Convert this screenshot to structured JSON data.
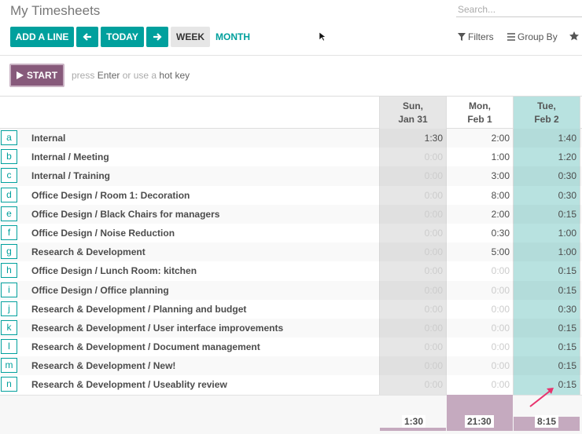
{
  "header": {
    "title": "My Timesheets",
    "search_placeholder": "Search..."
  },
  "toolbar": {
    "add_line": "ADD A LINE",
    "today": "TODAY",
    "week": "WEEK",
    "month": "MONTH",
    "filters": "Filters",
    "group_by": "Group By",
    "accent_color": "#00a09d"
  },
  "start": {
    "label": "START",
    "hint_press": "press",
    "hint_enter": "Enter",
    "hint_or": "or use a",
    "hint_hotkey": "hot key",
    "color": "#875a7b"
  },
  "columns": [
    {
      "day": "Sun,",
      "date": "Jan 31"
    },
    {
      "day": "Mon,",
      "date": "Feb 1"
    },
    {
      "day": "Tue,",
      "date": "Feb 2"
    }
  ],
  "rows": [
    {
      "key": "a",
      "task": "Internal",
      "sun": "1:30",
      "mon": "2:00",
      "tue": "1:40"
    },
    {
      "key": "b",
      "task": "Internal  /  Meeting",
      "sun": "0:00",
      "mon": "1:00",
      "tue": "1:20"
    },
    {
      "key": "c",
      "task": "Internal  /  Training",
      "sun": "0:00",
      "mon": "3:00",
      "tue": "0:30"
    },
    {
      "key": "d",
      "task": "Office Design  /  Room 1: Decoration",
      "sun": "0:00",
      "mon": "8:00",
      "tue": "0:30"
    },
    {
      "key": "e",
      "task": "Office Design  /  Black Chairs for managers",
      "sun": "0:00",
      "mon": "2:00",
      "tue": "0:15"
    },
    {
      "key": "f",
      "task": "Office Design  /  Noise Reduction",
      "sun": "0:00",
      "mon": "0:30",
      "tue": "1:00"
    },
    {
      "key": "g",
      "task": "Research & Development",
      "sun": "0:00",
      "mon": "5:00",
      "tue": "1:00"
    },
    {
      "key": "h",
      "task": "Office Design  /  Lunch Room: kitchen",
      "sun": "0:00",
      "mon": "0:00",
      "tue": "0:15"
    },
    {
      "key": "i",
      "task": "Office Design  /  Office planning",
      "sun": "0:00",
      "mon": "0:00",
      "tue": "0:15"
    },
    {
      "key": "j",
      "task": "Research & Development  /  Planning and budget",
      "sun": "0:00",
      "mon": "0:00",
      "tue": "0:30"
    },
    {
      "key": "k",
      "task": "Research & Development  /  User interface improvements",
      "sun": "0:00",
      "mon": "0:00",
      "tue": "0:15"
    },
    {
      "key": "l",
      "task": "Research & Development  /  Document management",
      "sun": "0:00",
      "mon": "0:00",
      "tue": "0:15"
    },
    {
      "key": "m",
      "task": "Research & Development  /  New!",
      "sun": "0:00",
      "mon": "0:00",
      "tue": "0:15"
    },
    {
      "key": "n",
      "task": "Research & Development  /  Useablity review",
      "sun": "0:00",
      "mon": "0:00",
      "tue": "0:15"
    }
  ],
  "totals": {
    "sun": "1:30",
    "mon": "21:30",
    "tue": "8:15",
    "bar_color": "#c5aabf"
  }
}
